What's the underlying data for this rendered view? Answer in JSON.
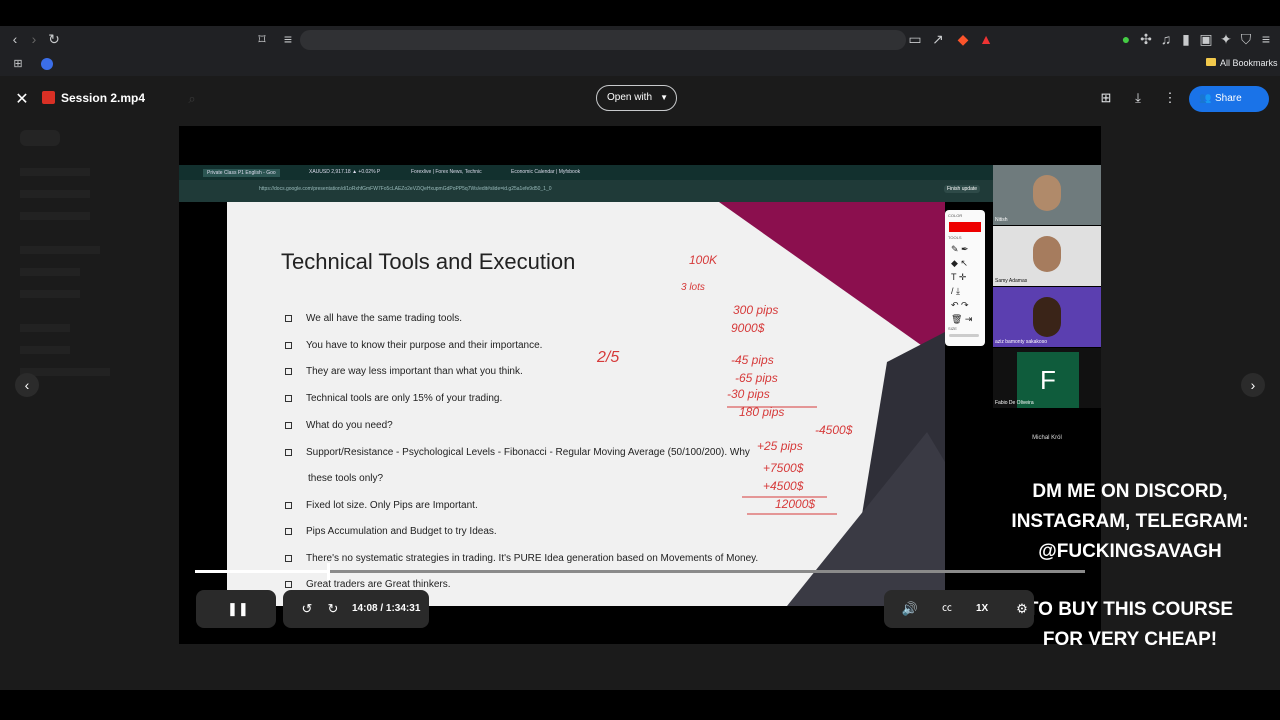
{
  "browser": {
    "bookmarks_label": "All Bookmarks"
  },
  "viewer": {
    "file_title": "Session 2.mp4",
    "open_with_label": "Open with",
    "share_label": "Share"
  },
  "video": {
    "slide": {
      "title": "Technical Tools and Execution",
      "bullets": [
        "We all have the same trading tools.",
        "You have to know their purpose and their importance.",
        "They are way less important than what you think.",
        "Technical tools are only 15% of your trading.",
        "What do you need?",
        "Support/Resistance - Psychological Levels - Fibonacci - Regular Moving Average (50/100/200). Why",
        "these tools only?",
        "Fixed lot size. Only Pips are Important.",
        "Pips Accumulation and Budget to try Ideas.",
        "There's no systematic strategies in trading. It's PURE Idea generation based on Movements of Money.",
        "Great traders are Great thinkers."
      ]
    },
    "handwriting": [
      "100K",
      "3 lots",
      "300 pips",
      "9000$",
      "2/5",
      "-45 pips",
      "-65 pips",
      "-30 pips",
      "180 pips",
      "+25 pips",
      "-4500$",
      "+7500$",
      "+4500$",
      "12000$"
    ],
    "inner_tabs": [
      "Private Class P1 English - Goo",
      "XAUUSD 2,917.18 ▲ +0.02% P",
      "Forexlive | Forex News, Technic",
      "Economic Calendar | Myfxbook"
    ],
    "inner_url": "https://docs.google.com/presentation/d/1oRxhfGmFW7Fo5cLAEZo2eVZiQeHxupmGdPoPP5q7Ws/edit#slide=id.g25a1efe9d50_1_0",
    "finish_update": "Finish update",
    "toolbar_labels": {
      "color": "COLOR",
      "tools": "TOOLS",
      "size": "SIZE"
    },
    "participants": [
      {
        "name": "Nitish"
      },
      {
        "name": "Samy Adamas"
      },
      {
        "name": "aziz bamonty sakakoso"
      },
      {
        "name": "Fabio De Oliveira",
        "initial": "F"
      },
      {
        "name": "Michal Król"
      }
    ],
    "promo_lines": [
      "DM ME ON DISCORD,",
      "INSTAGRAM, TELEGRAM:",
      "@FUCKINGSAVAGH"
    ],
    "promo_lines2": [
      "TO BUY THIS COURSE",
      "FOR VERY CHEAP!"
    ]
  },
  "player": {
    "time": "14:08 / 1:34:31",
    "speed": "1X",
    "progress": 0.1497
  },
  "icons": {
    "close": "close-icon",
    "pause": "pause-icon",
    "volume": "volume-icon"
  },
  "colors": {
    "share_button": "#1a73e8",
    "slide_accent": "#8b0f4e",
    "ink": "#d63a3a"
  }
}
